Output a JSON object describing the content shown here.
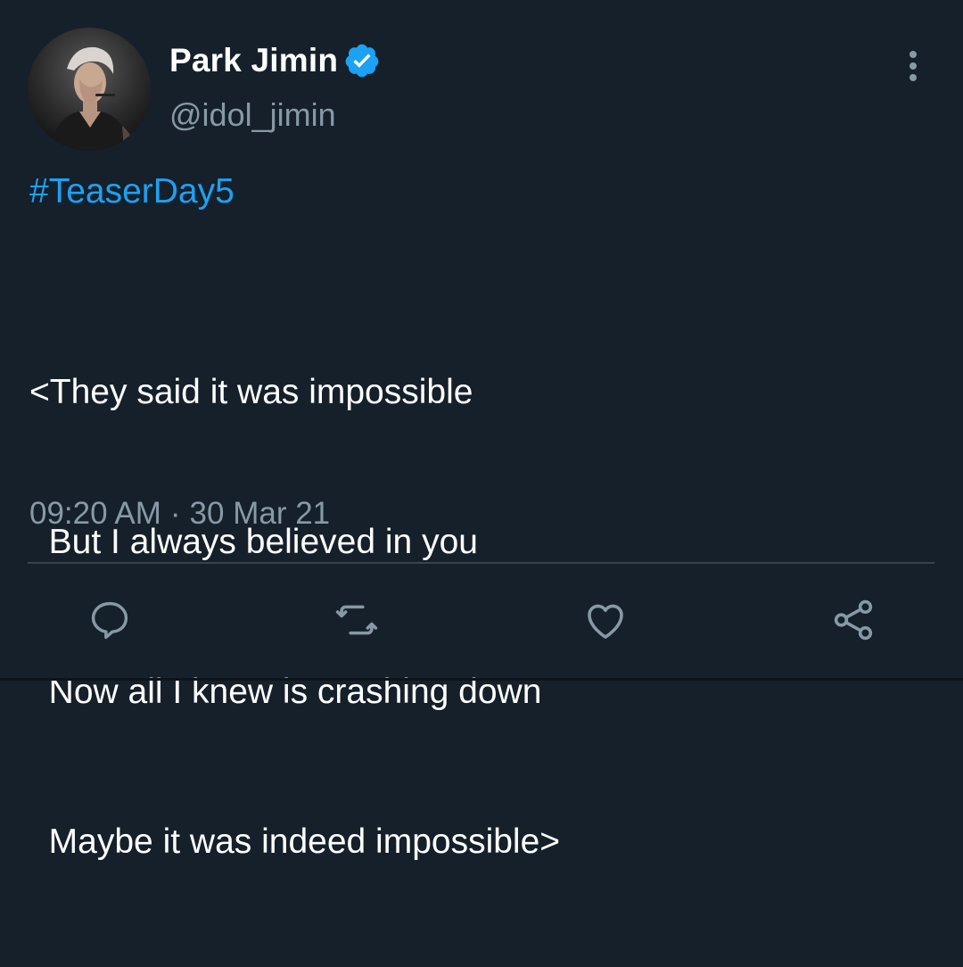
{
  "author": {
    "display_name": "Park Jimin",
    "handle": "@idol_jimin",
    "verified": true,
    "avatar_icon": "profile-photo"
  },
  "tweet": {
    "hashtag": "#TeaserDay5",
    "lines": [
      "<They said it was impossible",
      "  But I always believed in you",
      "  Now all I knew is crashing down",
      "  Maybe it was indeed impossible>"
    ],
    "time": "09:20 AM",
    "separator": "·",
    "date": "30 Mar 21"
  },
  "actions": [
    {
      "icon": "reply-icon"
    },
    {
      "icon": "retweet-icon"
    },
    {
      "icon": "like-icon"
    },
    {
      "icon": "share-icon"
    }
  ],
  "colors": {
    "background": "#15202b",
    "primary_text": "#ffffff",
    "secondary_text": "#8899a6",
    "accent": "#1da1f2",
    "divider": "#38444d"
  }
}
